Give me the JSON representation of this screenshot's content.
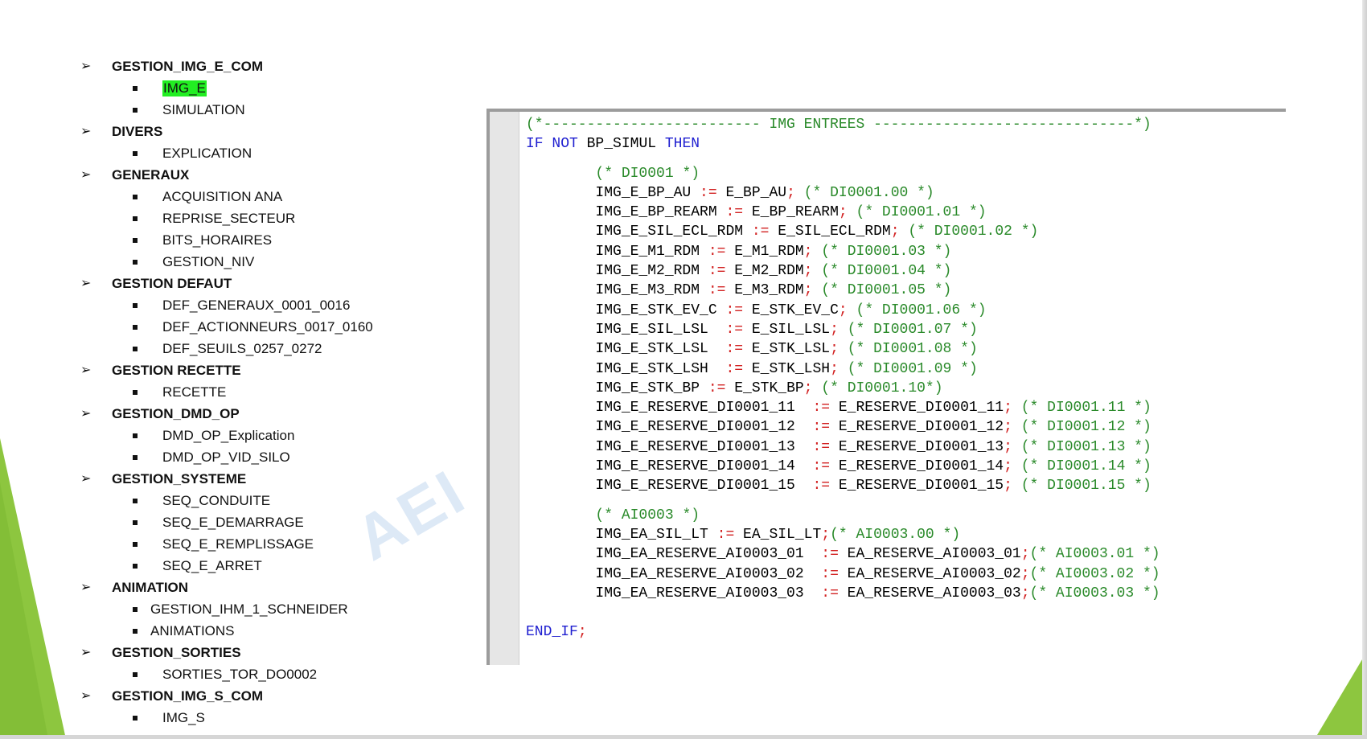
{
  "tree": [
    {
      "label": "GESTION_IMG_E_COM",
      "children": [
        {
          "label": "IMG_E",
          "highlight": true
        },
        {
          "label": "SIMULATION"
        }
      ]
    },
    {
      "label": "DIVERS",
      "children": [
        {
          "label": "EXPLICATION"
        }
      ]
    },
    {
      "label": "GENERAUX",
      "children": [
        {
          "label": "ACQUISITION ANA"
        },
        {
          "label": "REPRISE_SECTEUR"
        },
        {
          "label": "BITS_HORAIRES"
        },
        {
          "label": "GESTION_NIV"
        }
      ]
    },
    {
      "label": "GESTION DEFAUT",
      "children": [
        {
          "label": "DEF_GENERAUX_0001_0016"
        },
        {
          "label": "DEF_ACTIONNEURS_0017_0160"
        },
        {
          "label": "DEF_SEUILS_0257_0272"
        }
      ]
    },
    {
      "label": "GESTION RECETTE",
      "children": [
        {
          "label": "RECETTE"
        }
      ]
    },
    {
      "label": "GESTION_DMD_OP",
      "children": [
        {
          "label": "DMD_OP_Explication"
        },
        {
          "label": "DMD_OP_VID_SILO"
        }
      ]
    },
    {
      "label": "GESTION_SYSTEME",
      "children": [
        {
          "label": "SEQ_CONDUITE"
        },
        {
          "label": "SEQ_E_DEMARRAGE"
        },
        {
          "label": "SEQ_E_REMPLISSAGE"
        },
        {
          "label": "SEQ_E_ARRET"
        }
      ]
    },
    {
      "label": "ANIMATION",
      "children": [
        {
          "label": "GESTION_IHM_1_SCHNEIDER",
          "shallow": true
        },
        {
          "label": "ANIMATIONS",
          "shallow": true
        }
      ]
    },
    {
      "label": "GESTION_SORTIES",
      "children": [
        {
          "label": "SORTIES_TOR_DO0002"
        }
      ]
    },
    {
      "label": "GESTION_IMG_S_COM",
      "children": [
        {
          "label": "IMG_S"
        }
      ]
    }
  ],
  "watermark": "AEI",
  "code": {
    "header_comment": "(*------------------------- IMG ENTREES ------------------------------*)",
    "if_line": {
      "kw1": "IF",
      "kw2": "NOT",
      "var": "BP_SIMUL",
      "kw3": "THEN"
    },
    "di_comment": "(* DI0001 *)",
    "di_lines": [
      {
        "lhs": "IMG_E_BP_AU ",
        "rhs": " E_BP_AU",
        "cm": "(* DI0001.00 *)"
      },
      {
        "lhs": "IMG_E_BP_REARM ",
        "rhs": " E_BP_REARM",
        "cm": "(* DI0001.01 *)"
      },
      {
        "lhs": "IMG_E_SIL_ECL_RDM ",
        "rhs": " E_SIL_ECL_RDM",
        "cm": "(* DI0001.02 *)"
      },
      {
        "lhs": "IMG_E_M1_RDM ",
        "rhs": " E_M1_RDM",
        "cm": "(* DI0001.03 *)"
      },
      {
        "lhs": "IMG_E_M2_RDM ",
        "rhs": " E_M2_RDM",
        "cm": "(* DI0001.04 *)"
      },
      {
        "lhs": "IMG_E_M3_RDM ",
        "rhs": " E_M3_RDM",
        "cm": "(* DI0001.05 *)"
      },
      {
        "lhs": "IMG_E_STK_EV_C ",
        "rhs": " E_STK_EV_C",
        "cm": "(* DI0001.06 *)"
      },
      {
        "lhs": "IMG_E_SIL_LSL  ",
        "rhs": " E_SIL_LSL",
        "cm": "(* DI0001.07 *)"
      },
      {
        "lhs": "IMG_E_STK_LSL  ",
        "rhs": " E_STK_LSL",
        "cm": "(* DI0001.08 *)"
      },
      {
        "lhs": "IMG_E_STK_LSH  ",
        "rhs": " E_STK_LSH",
        "cm": "(* DI0001.09 *)"
      },
      {
        "lhs": "IMG_E_STK_BP ",
        "rhs": " E_STK_BP",
        "cm": "(* DI0001.10*)"
      },
      {
        "lhs": "IMG_E_RESERVE_DI0001_11  ",
        "rhs": " E_RESERVE_DI0001_11",
        "cm": "(* DI0001.11 *)"
      },
      {
        "lhs": "IMG_E_RESERVE_DI0001_12  ",
        "rhs": " E_RESERVE_DI0001_12",
        "cm": "(* DI0001.12 *)"
      },
      {
        "lhs": "IMG_E_RESERVE_DI0001_13  ",
        "rhs": " E_RESERVE_DI0001_13",
        "cm": "(* DI0001.13 *)"
      },
      {
        "lhs": "IMG_E_RESERVE_DI0001_14  ",
        "rhs": " E_RESERVE_DI0001_14",
        "cm": "(* DI0001.14 *)"
      },
      {
        "lhs": "IMG_E_RESERVE_DI0001_15  ",
        "rhs": " E_RESERVE_DI0001_15",
        "cm": "(* DI0001.15 *)"
      }
    ],
    "ai_comment": "(* AI0003 *)",
    "ai_lines": [
      {
        "lhs": "IMG_EA_SIL_LT ",
        "rhs": " EA_SIL_LT",
        "cm": "(* AI0003.00 *)"
      },
      {
        "lhs": "IMG_EA_RESERVE_AI0003_01  ",
        "rhs": " EA_RESERVE_AI0003_01",
        "cm": "(* AI0003.01 *)"
      },
      {
        "lhs": "IMG_EA_RESERVE_AI0003_02  ",
        "rhs": " EA_RESERVE_AI0003_02",
        "cm": "(* AI0003.02 *)"
      },
      {
        "lhs": "IMG_EA_RESERVE_AI0003_03  ",
        "rhs": " EA_RESERVE_AI0003_03",
        "cm": "(* AI0003.03 *)"
      }
    ],
    "end_line": "END_IF",
    "assign_op": ":=",
    "semicolon": ";"
  },
  "colors": {
    "keyword": "#1f1fd0",
    "comment": "#2a8a2a",
    "operator": "#d22222",
    "highlight": "#22ee22",
    "accent_green": "#8dc63f"
  }
}
